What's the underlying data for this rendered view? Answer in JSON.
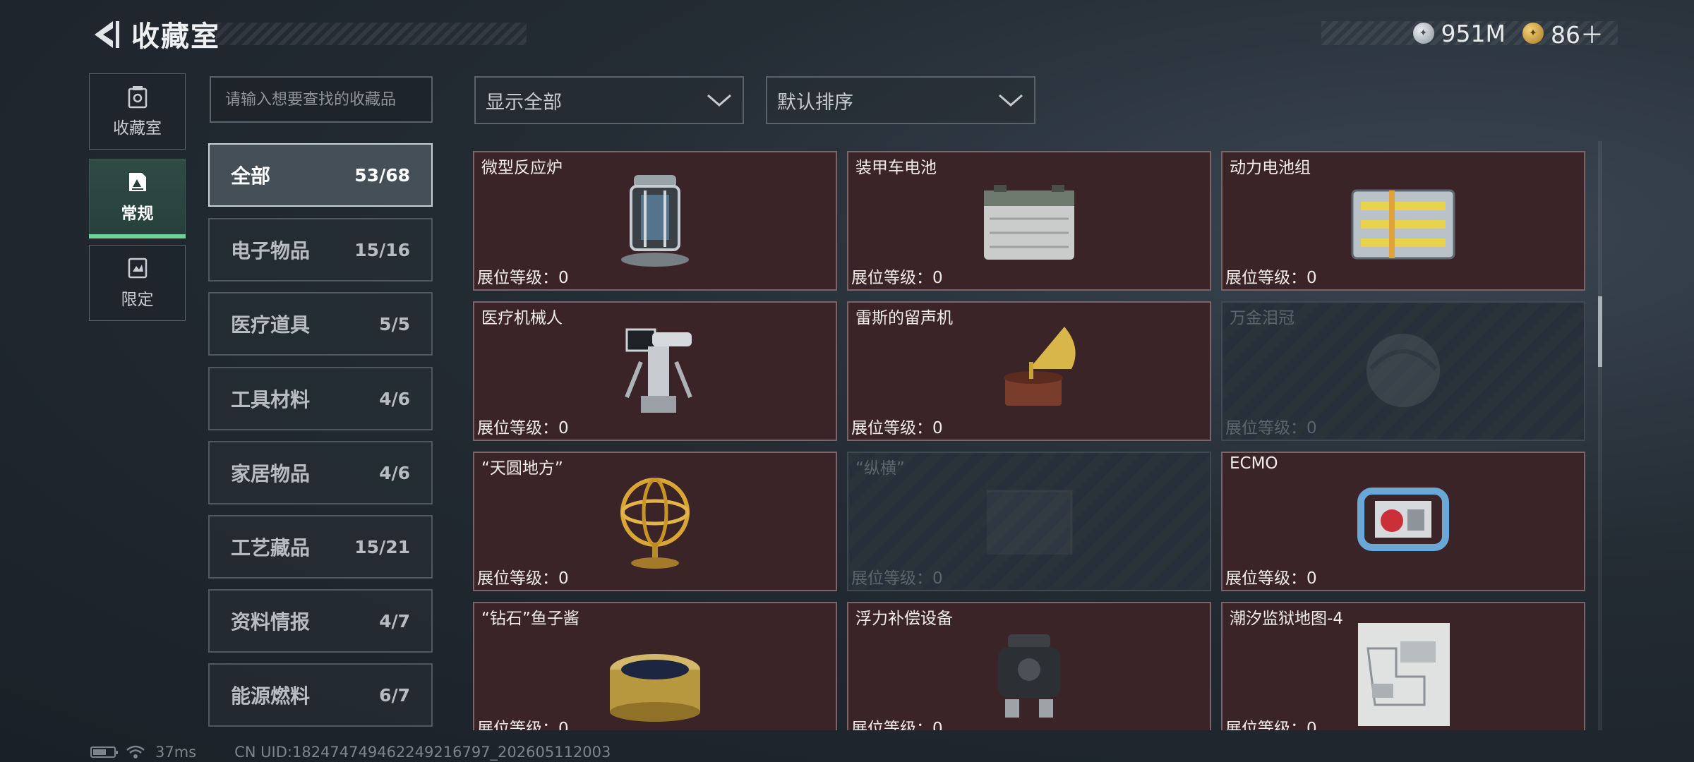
{
  "header": {
    "title": "收藏室",
    "back_icon": "back-arrow-icon",
    "currency": [
      {
        "icon": "silver-coin-icon",
        "value": "951M"
      },
      {
        "icon": "gold-coin-icon",
        "value": "86＋"
      }
    ]
  },
  "side_tabs": [
    {
      "label": "收藏室",
      "icon": "collection-room-icon",
      "active": false
    },
    {
      "label": "常规",
      "icon": "regular-icon",
      "active": true
    },
    {
      "label": "限定",
      "icon": "limited-icon",
      "active": false
    }
  ],
  "search": {
    "placeholder": "请输入想要查找的收藏品",
    "value": ""
  },
  "filters": {
    "display": {
      "value": "显示全部"
    },
    "sort": {
      "value": "默认排序"
    }
  },
  "categories": [
    {
      "name": "全部",
      "count": "53/68",
      "active": true
    },
    {
      "name": "电子物品",
      "count": "15/16",
      "active": false
    },
    {
      "name": "医疗道具",
      "count": "5/5",
      "active": false
    },
    {
      "name": "工具材料",
      "count": "4/6",
      "active": false
    },
    {
      "name": "家居物品",
      "count": "4/6",
      "active": false
    },
    {
      "name": "工艺藏品",
      "count": "15/21",
      "active": false
    },
    {
      "name": "资料情报",
      "count": "4/7",
      "active": false
    },
    {
      "name": "能源燃料",
      "count": "6/7",
      "active": false
    }
  ],
  "level_label": "展位等级：",
  "items": [
    {
      "name": "",
      "level": "0",
      "locked": false,
      "art": "none"
    },
    {
      "name": "",
      "level": "0",
      "locked": false,
      "art": "none"
    },
    {
      "name": "",
      "level": "0",
      "locked": false,
      "art": "none"
    },
    {
      "name": "微型反应炉",
      "level": "0",
      "locked": false,
      "art": "reactor"
    },
    {
      "name": "装甲车电池",
      "level": "0",
      "locked": false,
      "art": "battery"
    },
    {
      "name": "动力电池组",
      "level": "0",
      "locked": false,
      "art": "battery-pack"
    },
    {
      "name": "医疗机械人",
      "level": "0",
      "locked": false,
      "art": "robot"
    },
    {
      "name": "雷斯的留声机",
      "level": "0",
      "locked": false,
      "art": "gramophone"
    },
    {
      "name": "万金泪冠",
      "level": "0",
      "locked": true,
      "art": "crown"
    },
    {
      "name": "“天圆地方”",
      "level": "0",
      "locked": false,
      "art": "armillary"
    },
    {
      "name": "“纵横”",
      "level": "0",
      "locked": true,
      "art": "board"
    },
    {
      "name": "ECMO",
      "level": "0",
      "locked": false,
      "art": "ecmo"
    },
    {
      "name": "“钻石”鱼子酱",
      "level": "0",
      "locked": false,
      "art": "caviar"
    },
    {
      "name": "浮力补偿设备",
      "level": "0",
      "locked": false,
      "art": "bcd"
    },
    {
      "name": "潮汐监狱地图-4",
      "level": "0",
      "locked": false,
      "art": "map"
    }
  ],
  "status_bar": {
    "ping": "37ms",
    "uid": "CN UID:1824747494622492167​97_202605112003"
  }
}
